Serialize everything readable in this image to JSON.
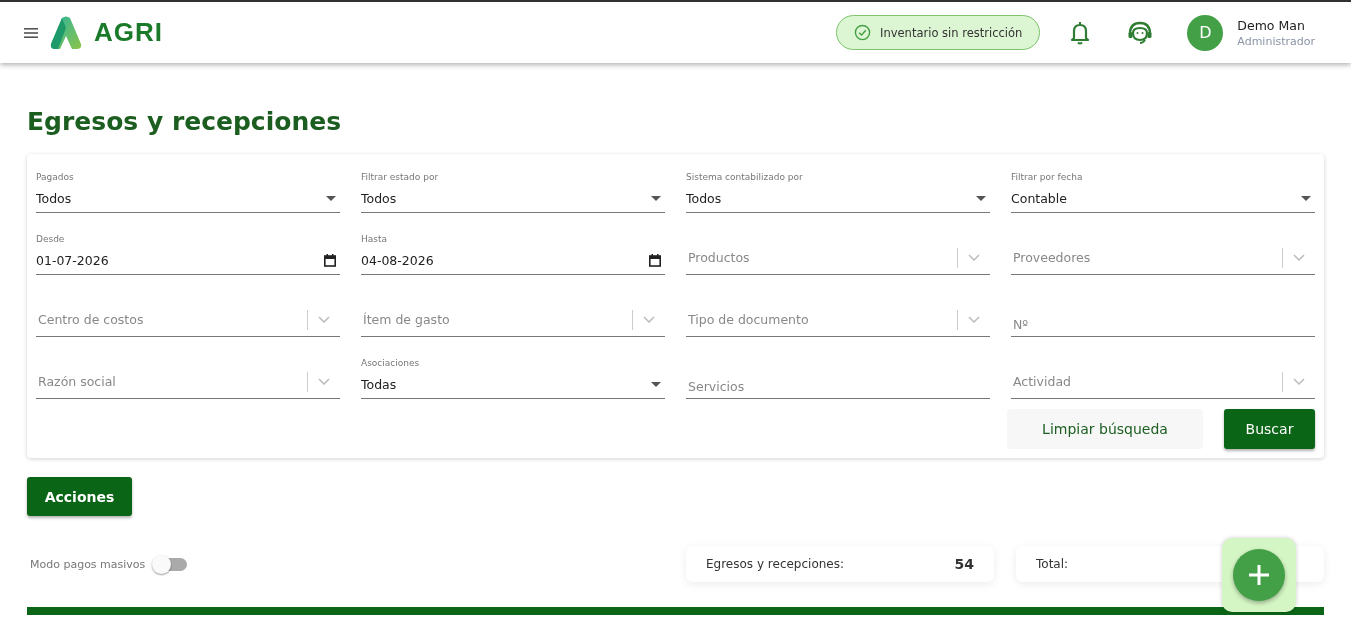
{
  "header": {
    "brand": "AGRI",
    "inventory_badge": "Inventario sin restricción",
    "user": {
      "initial": "D",
      "name": "Demo Man",
      "role": "Administrador"
    }
  },
  "page_title": "Egresos y recepciones",
  "filters": [
    {
      "kind": "select",
      "label": "Pagados",
      "value": "Todos"
    },
    {
      "kind": "select",
      "label": "Filtrar estado por",
      "value": "Todos"
    },
    {
      "kind": "select",
      "label": "Sistema contabilizado por",
      "value": "Todos"
    },
    {
      "kind": "select",
      "label": "Filtrar por fecha",
      "value": "Contable"
    },
    {
      "kind": "date",
      "label": "Desde",
      "value": "01-07-2026"
    },
    {
      "kind": "date",
      "label": "Hasta",
      "value": "04-08-2026"
    },
    {
      "kind": "combo",
      "placeholder": "Productos"
    },
    {
      "kind": "combo",
      "placeholder": "Proveedores"
    },
    {
      "kind": "combo",
      "placeholder": "Centro de costos"
    },
    {
      "kind": "combo",
      "placeholder": "Ítem de gasto"
    },
    {
      "kind": "combo",
      "placeholder": "Tipo de documento"
    },
    {
      "kind": "text",
      "placeholder": "Nº"
    },
    {
      "kind": "combo",
      "placeholder": "Razón social"
    },
    {
      "kind": "select",
      "label": "Asociaciones",
      "value": "Todas"
    },
    {
      "kind": "text",
      "placeholder": "Servicios"
    },
    {
      "kind": "combo",
      "placeholder": "Actividad"
    }
  ],
  "filter_buttons": [
    "Limpiar búsqueda",
    "Buscar"
  ],
  "actions_button": "Acciones",
  "bulk_mode": {
    "label": "Modo pagos masivos",
    "on": false
  },
  "summary": [
    {
      "label": "Egresos y recepciones:",
      "value": "54"
    },
    {
      "label": "Total:"
    }
  ]
}
